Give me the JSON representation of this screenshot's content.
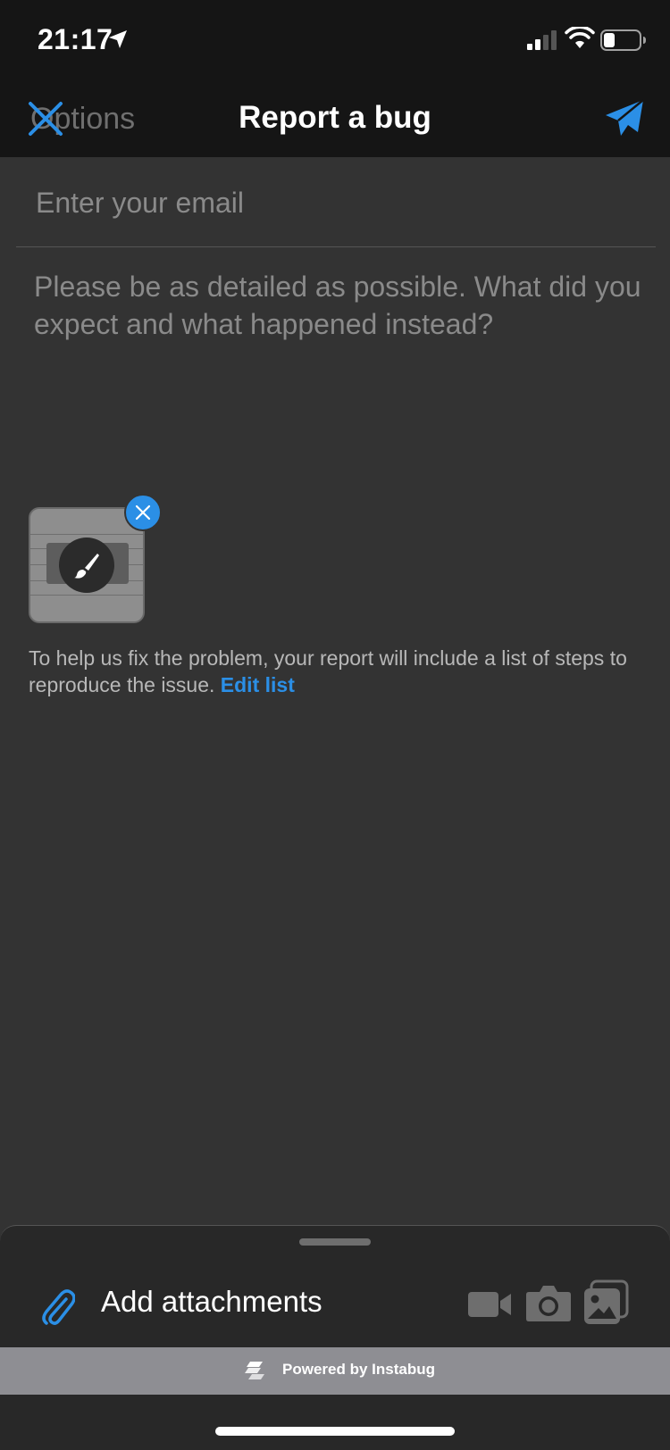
{
  "status_bar": {
    "time": "21:17",
    "icons": [
      "location-arrow-icon",
      "cellular-signal-icon",
      "wifi-icon",
      "battery-icon"
    ]
  },
  "nav": {
    "left_label": "Options",
    "title": "Report a bug",
    "send_icon": "send-icon"
  },
  "form": {
    "email_placeholder": "Enter your email",
    "description_placeholder": "Please be as detailed as possible. What did you expect and what happened instead?"
  },
  "attachment": {
    "thumbnail": "screenshot-thumbnail",
    "edit_icon": "brush-icon",
    "remove_icon": "close-icon"
  },
  "repro_steps": {
    "text": "To help us fix the problem, your report will include a list of steps to reproduce the issue. ",
    "link": "Edit list"
  },
  "attachments_bar": {
    "label": "Add attachments",
    "icons": [
      "paperclip-icon",
      "video-camera-icon",
      "camera-icon",
      "gallery-icon"
    ]
  },
  "footer": {
    "powered_by": "Powered by Instabug"
  },
  "colors": {
    "accent": "#2b8fe6",
    "background": "#333333",
    "header": "#151515",
    "footer_bar": "#8e8e93"
  }
}
